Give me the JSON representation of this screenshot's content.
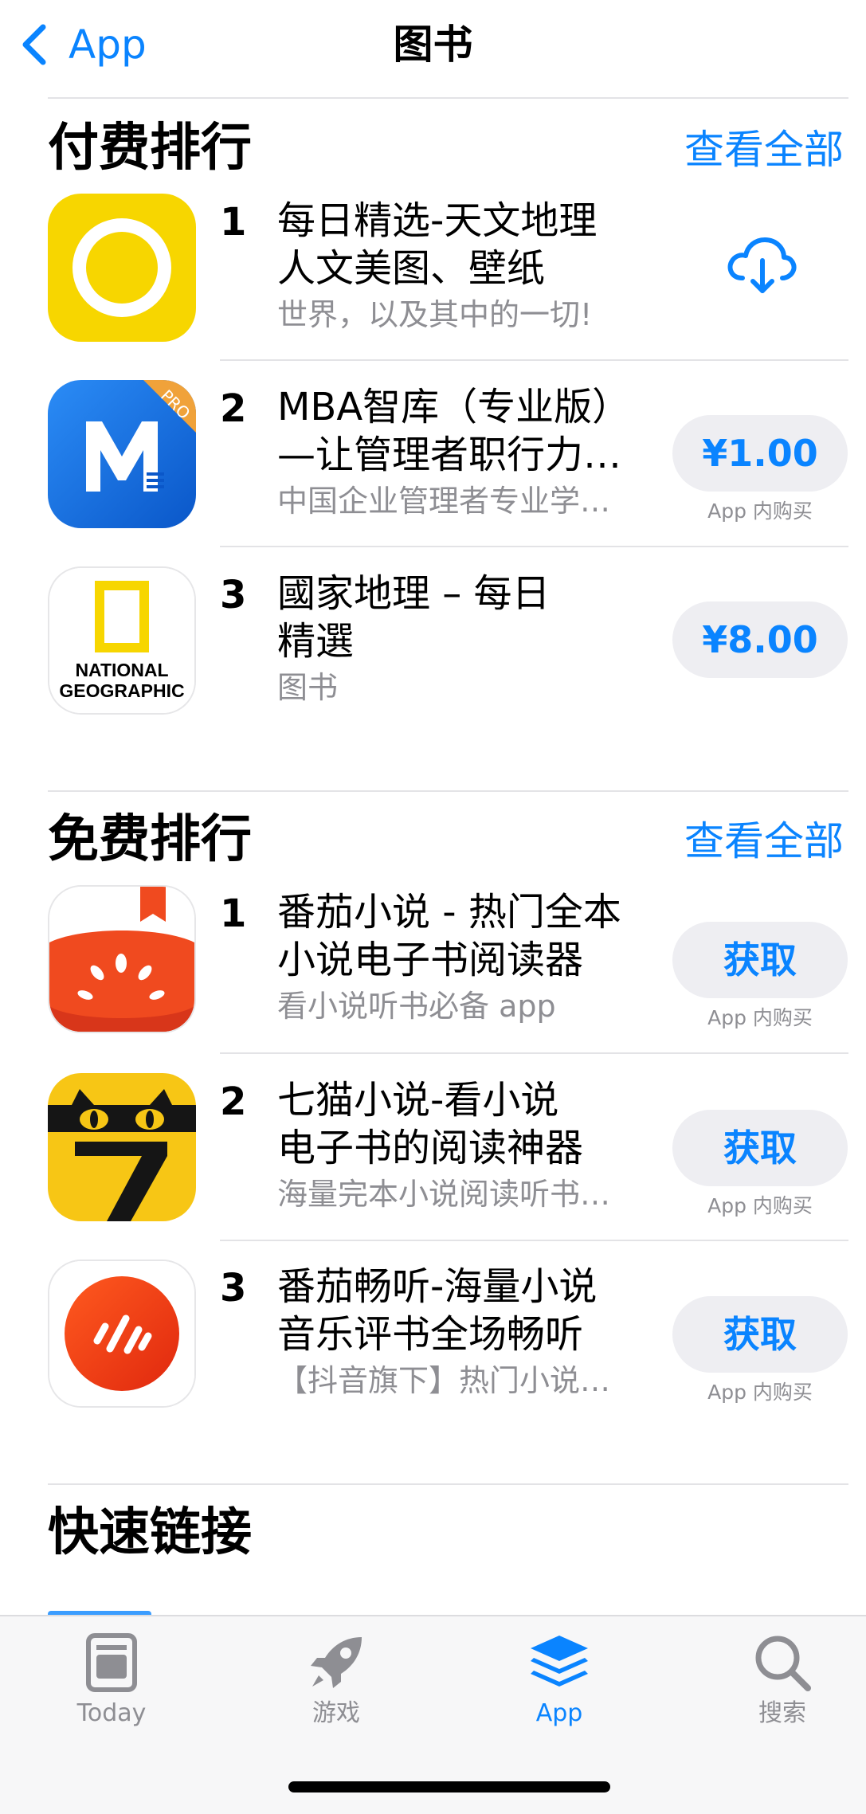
{
  "nav": {
    "back_label": "App",
    "title": "图书"
  },
  "paid": {
    "title": "付费排行",
    "see_all": "查看全部",
    "items": [
      {
        "rank": "1",
        "name": "每日精选-天文地理\n人文美图、壁纸",
        "subtitle": "世界，以及其中的一切!",
        "action": "download"
      },
      {
        "rank": "2",
        "name": "MBA智库（专业版）\n—让管理者职行力…",
        "subtitle": "中国企业管理者专业学…",
        "action": "¥1.00",
        "iap": "App 内购买"
      },
      {
        "rank": "3",
        "name": "國家地理 – 每日\n精選",
        "subtitle": "图书",
        "action": "¥8.00"
      }
    ]
  },
  "free": {
    "title": "免费排行",
    "see_all": "查看全部",
    "items": [
      {
        "rank": "1",
        "name": "番茄小说 - 热门全本\n小说电子书阅读器",
        "subtitle": "看小说听书必备 app",
        "action": "获取",
        "iap": "App 内购买"
      },
      {
        "rank": "2",
        "name": "七猫小说-看小说\n电子书的阅读神器",
        "subtitle": "海量完本小说阅读听书…",
        "action": "获取",
        "iap": "App 内购买"
      },
      {
        "rank": "3",
        "name": "番茄畅听-海量小说\n音乐评书全场畅听",
        "subtitle": "【抖音旗下】热门小说评…",
        "action": "获取",
        "iap": "App 内购买"
      }
    ]
  },
  "quick_links": {
    "title": "快速链接"
  },
  "natgeo_logo_text": "NATIONAL GEOGRAPHIC",
  "tabbar": {
    "tabs": [
      {
        "label": "Today",
        "icon": "today-icon",
        "active": false
      },
      {
        "label": "游戏",
        "icon": "rocket-icon",
        "active": false
      },
      {
        "label": "App",
        "icon": "app-stack-icon",
        "active": true
      },
      {
        "label": "搜索",
        "icon": "search-icon",
        "active": false
      }
    ]
  },
  "colors": {
    "accent": "#0a84ff",
    "secondary_text": "#8e8e93",
    "pill_bg": "#eeeef2"
  }
}
